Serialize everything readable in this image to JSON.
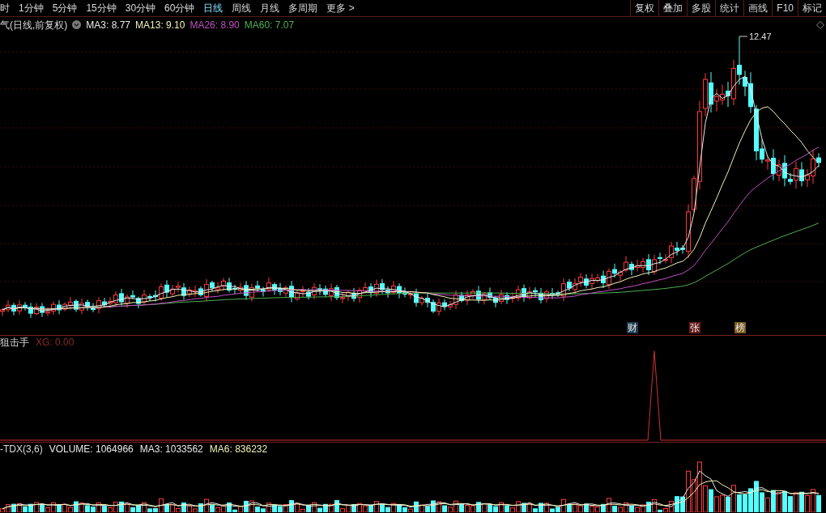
{
  "timeframe_tabs": [
    {
      "label": "时",
      "selected": false
    },
    {
      "label": "1分钟",
      "selected": false
    },
    {
      "label": "5分钟",
      "selected": false
    },
    {
      "label": "15分钟",
      "selected": false
    },
    {
      "label": "30分钟",
      "selected": false
    },
    {
      "label": "60分钟",
      "selected": false
    },
    {
      "label": "日线",
      "selected": true
    },
    {
      "label": "周线",
      "selected": false
    },
    {
      "label": "月线",
      "selected": false
    },
    {
      "label": "多周期",
      "selected": false
    },
    {
      "label": "更多 >",
      "selected": false
    }
  ],
  "tool_buttons": [
    "复权",
    "叠加",
    "多股",
    "统计",
    "画线",
    "F10",
    "标记"
  ],
  "main_chart": {
    "title": "气(日线,前复权)",
    "indicators": [
      {
        "label": "MA3: 8.77",
        "color": "#e8e8e8"
      },
      {
        "label": "MA13: 9.10",
        "color": "#f0f0b8"
      },
      {
        "label": "MA26: 8.90",
        "color": "#c050c0"
      },
      {
        "label": "MA60: 7.07",
        "color": "#4caf50"
      }
    ],
    "peak_label": "12.47",
    "events": [
      {
        "label": "财",
        "color": "#1e3c50"
      },
      {
        "label": "张",
        "color": "#6a1c1c"
      },
      {
        "label": "榜",
        "color": "#7a5a20"
      }
    ]
  },
  "signal_panel": {
    "title": "狙击手",
    "indicator": "XG: 0.00"
  },
  "volume_panel": {
    "title": "-TDX(3,6)",
    "indicators": [
      {
        "label": "VOLUME: 1064966",
        "color": "#e8e8e8"
      },
      {
        "label": "MA3: 1033562",
        "color": "#e8e8e8"
      },
      {
        "label": "MA6: 836232",
        "color": "#f0f0b8"
      }
    ]
  }
}
